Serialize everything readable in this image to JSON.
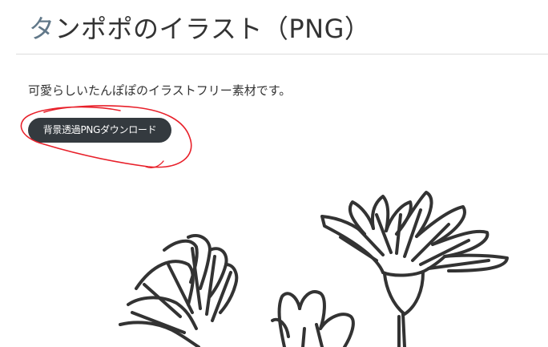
{
  "article": {
    "title_first": "タ",
    "title_rest": "ンポポのイラスト（PNG）",
    "description": "可愛らしいたんぽぽのイラストフリー素材です。",
    "download_label": "背景透過PNGダウンロード"
  },
  "annotation": {
    "color": "#e8202a"
  },
  "icons": {
    "illustration": "dandelion-line-drawing"
  }
}
